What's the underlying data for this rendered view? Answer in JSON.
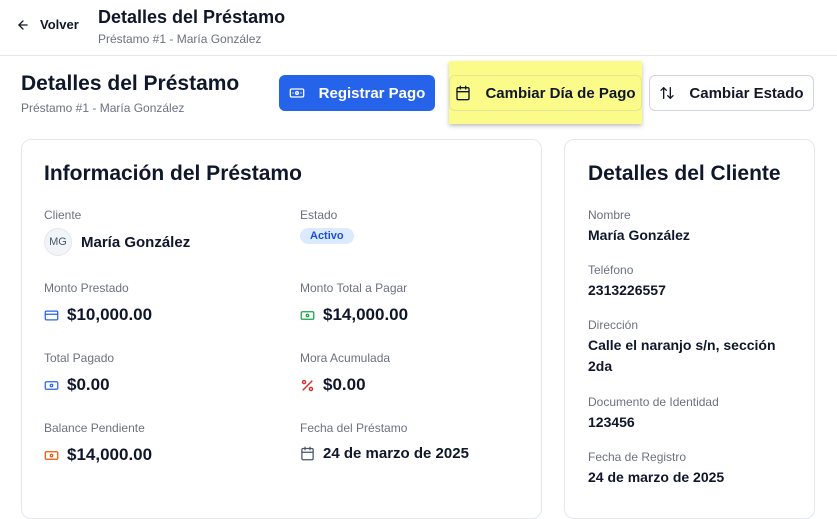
{
  "header": {
    "back_label": "Volver",
    "title": "Detalles del Préstamo",
    "subtitle": "Préstamo #1 - María González"
  },
  "page": {
    "title": "Detalles del Préstamo",
    "subtitle": "Préstamo #1 - María González"
  },
  "actions": {
    "registrar_pago": "Registrar Pago",
    "cambiar_dia": "Cambiar Día de Pago",
    "cambiar_estado": "Cambiar Estado"
  },
  "loan": {
    "title": "Información del Préstamo",
    "cliente_label": "Cliente",
    "cliente_initials": "MG",
    "cliente_name": "María González",
    "estado_label": "Estado",
    "estado_value": "Activo",
    "monto_prestado_label": "Monto Prestado",
    "monto_prestado_value": "$10,000.00",
    "monto_total_label": "Monto Total a Pagar",
    "monto_total_value": "$14,000.00",
    "total_pagado_label": "Total Pagado",
    "total_pagado_value": "$0.00",
    "mora_label": "Mora Acumulada",
    "mora_value": "$0.00",
    "balance_label": "Balance Pendiente",
    "balance_value": "$14,000.00",
    "fecha_label": "Fecha del Préstamo",
    "fecha_value": "24 de marzo de 2025"
  },
  "client": {
    "title": "Detalles del Cliente",
    "nombre_label": "Nombre",
    "nombre_value": "María González",
    "telefono_label": "Teléfono",
    "telefono_value": "2313226557",
    "direccion_label": "Dirección",
    "direccion_value": "Calle el naranjo s/n, sección 2da",
    "documento_label": "Documento de Identidad",
    "documento_value": "123456",
    "registro_label": "Fecha de Registro",
    "registro_value": "24 de marzo de 2025"
  },
  "colors": {
    "primary": "#2563eb",
    "highlight": "#fbfb8a",
    "badge_bg": "#dbeafe",
    "badge_text": "#1d4ed8"
  }
}
